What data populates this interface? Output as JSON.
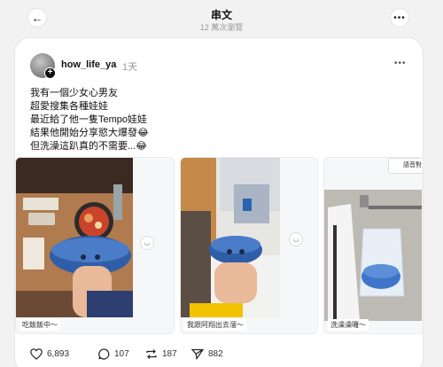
{
  "header": {
    "title": "串文",
    "views": "12 萬次瀏覽"
  },
  "post": {
    "username": "how_life_ya",
    "time": "1天",
    "lines": [
      "我有一個少女心男友",
      "超愛搜集各種娃娃",
      "最近給了他一隻Tempo娃娃",
      "結果他開始分享慾大爆發😂",
      "但洗澡這趴真的不需要...😂"
    ],
    "media": [
      {
        "caption": "吃飯飯中～"
      },
      {
        "caption": "我跟阿翔出去溜～"
      },
      {
        "caption": "洗澡澡囉～",
        "call_label": "語音對"
      }
    ],
    "stats": {
      "likes": "6,893",
      "comments": "107",
      "reposts": "187",
      "shares": "882"
    }
  }
}
